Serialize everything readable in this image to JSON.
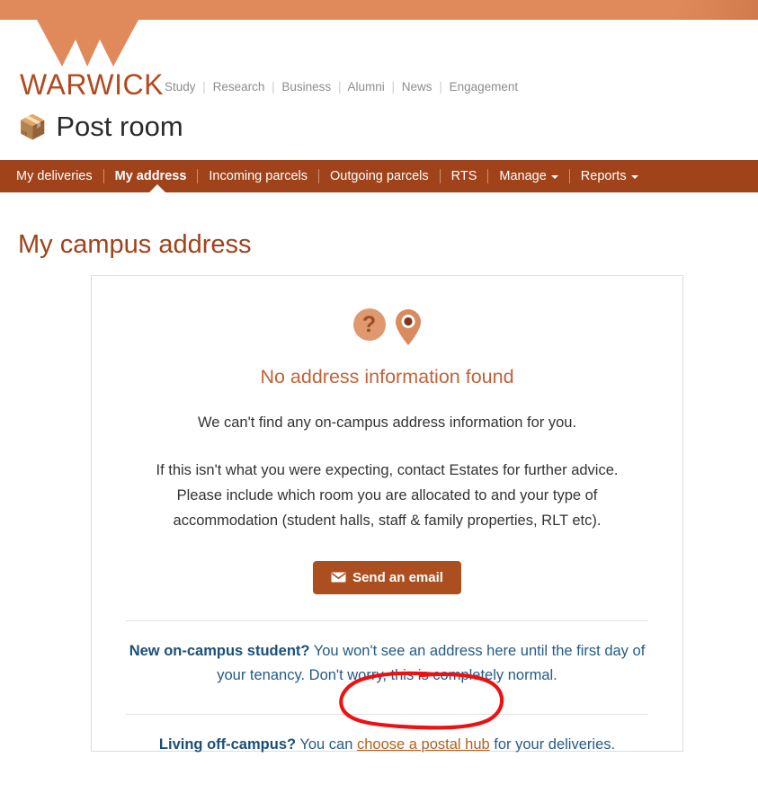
{
  "brand": {
    "wordmark": "WARWICK",
    "banner_color": "#e08a5b",
    "accent_color": "#a0421a",
    "links": [
      "Study",
      "Research",
      "Business",
      "Alumni",
      "News",
      "Engagement"
    ],
    "separator": "|"
  },
  "app": {
    "title": "Post room",
    "icon": "package-box-emoji",
    "icon_glyph": "📦"
  },
  "nav": {
    "items": [
      {
        "label": "My deliveries",
        "active": false,
        "has_dropdown": false
      },
      {
        "label": "My address",
        "active": true,
        "has_dropdown": false
      },
      {
        "label": "Incoming parcels",
        "active": false,
        "has_dropdown": false
      },
      {
        "label": "Outgoing parcels",
        "active": false,
        "has_dropdown": false
      },
      {
        "label": "RTS",
        "active": false,
        "has_dropdown": false
      },
      {
        "label": "Manage",
        "active": false,
        "has_dropdown": true
      },
      {
        "label": "Reports",
        "active": false,
        "has_dropdown": true
      }
    ]
  },
  "page": {
    "heading": "My campus address"
  },
  "card": {
    "title": "No address information found",
    "lead": "We can't find any on-campus address information for you.",
    "paragraph": "If this isn't what you were expecting, contact Estates for further advice. Please include which room you are allocated to and your type of accommodation (student halls, staff & family properties, RLT etc).",
    "button": {
      "label": "Send an email",
      "icon": "envelope-icon",
      "color": "#ab4f21"
    },
    "notes": [
      {
        "lead": "New on-campus student?",
        "text": " You won't see an address here until the first day of your tenancy. Don't worry, this is completely normal.",
        "link": null,
        "tail": null
      },
      {
        "lead": "Living off-campus?",
        "text": " You can ",
        "link": "choose a postal hub",
        "tail": " for your deliveries."
      }
    ]
  },
  "annotation": {
    "shape": "hand-drawn-ellipse",
    "color": "#ee1111",
    "targets": "choose a postal hub"
  }
}
